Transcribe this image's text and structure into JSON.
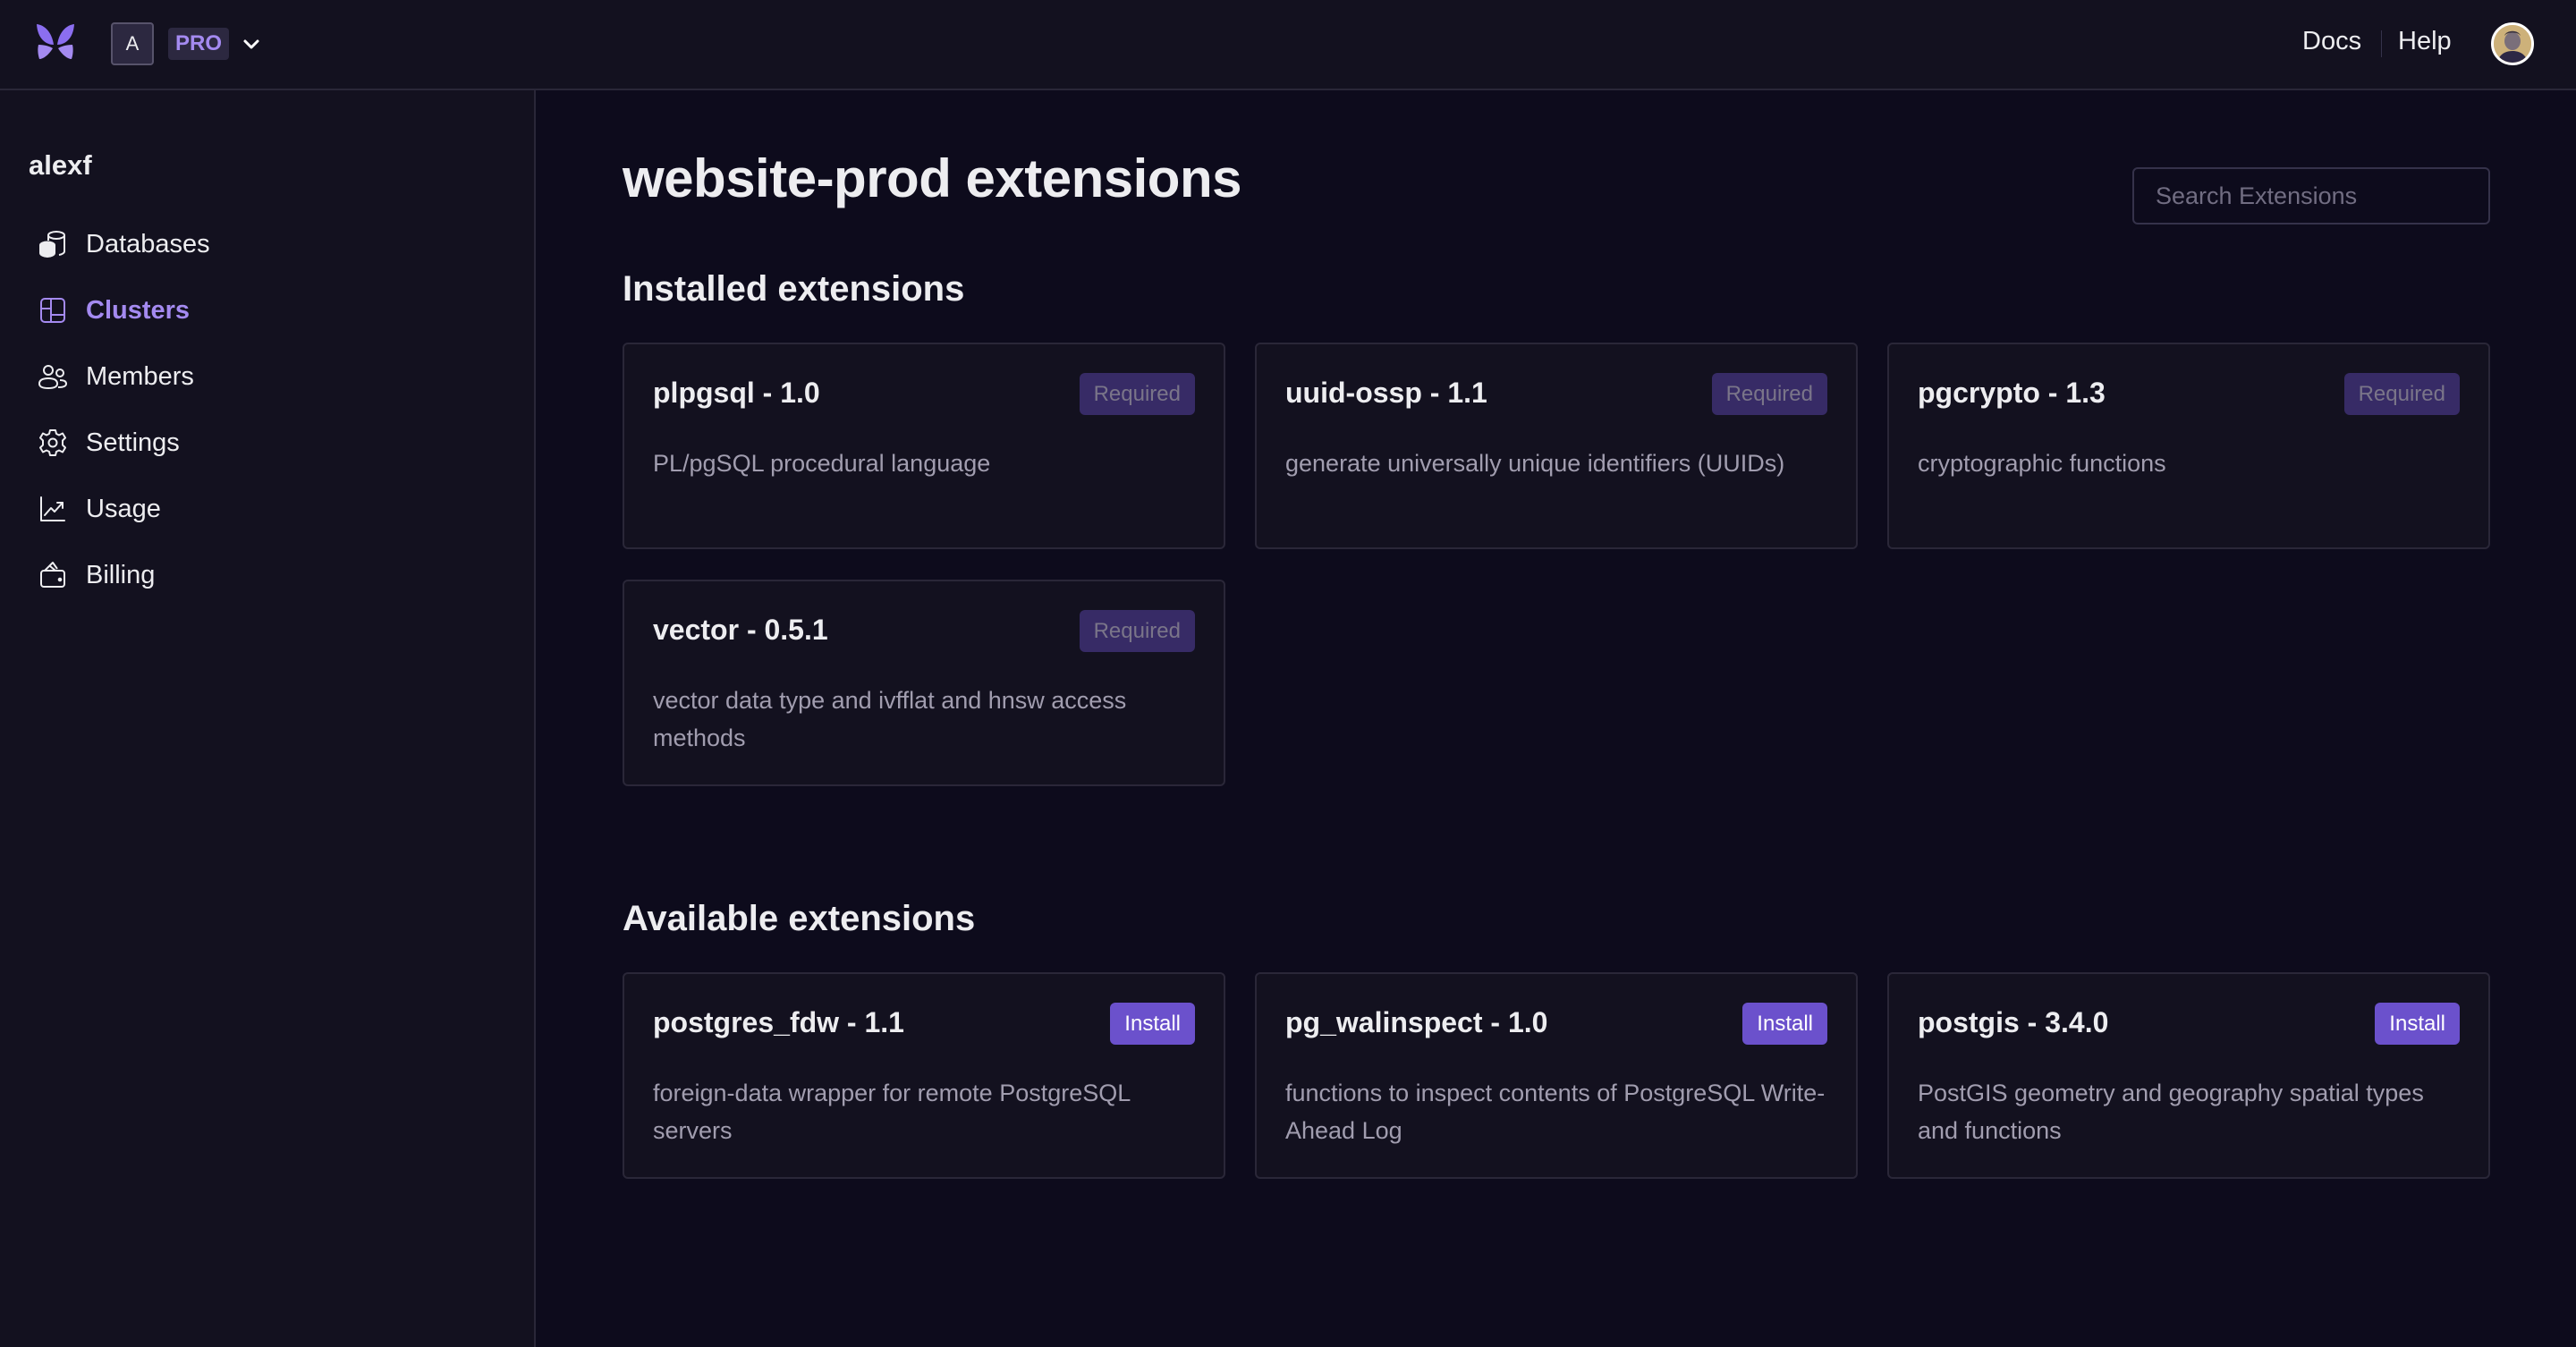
{
  "header": {
    "logo_icon": "butterfly-logo-icon",
    "org_initial": "A",
    "plan": "PRO",
    "org_menu_icon": "chevron-down-icon",
    "links": [
      {
        "label": "Docs"
      },
      {
        "label": "Help"
      }
    ],
    "avatar_icon": "user-avatar"
  },
  "sidebar": {
    "user": "alexf",
    "items": [
      {
        "label": "Databases",
        "icon": "database-icon",
        "active": false
      },
      {
        "label": "Clusters",
        "icon": "clusters-icon",
        "active": true
      },
      {
        "label": "Members",
        "icon": "members-icon",
        "active": false
      },
      {
        "label": "Settings",
        "icon": "gear-icon",
        "active": false
      },
      {
        "label": "Usage",
        "icon": "chart-line-icon",
        "active": false
      },
      {
        "label": "Billing",
        "icon": "wallet-icon",
        "active": false
      }
    ]
  },
  "main": {
    "title": "website-prod extensions",
    "search": {
      "placeholder": "Search Extensions",
      "value": ""
    },
    "installed": {
      "title": "Installed extensions",
      "items": [
        {
          "name": "plpgsql - 1.0",
          "description": "PL/pgSQL procedural language",
          "badge": "Required"
        },
        {
          "name": "uuid-ossp - 1.1",
          "description": "generate universally unique identifiers (UUIDs)",
          "badge": "Required"
        },
        {
          "name": "pgcrypto - 1.3",
          "description": "cryptographic functions",
          "badge": "Required"
        },
        {
          "name": "vector - 0.5.1",
          "description": "vector data type and ivfflat and hnsw access methods",
          "badge": "Required"
        }
      ]
    },
    "available": {
      "title": "Available extensions",
      "items": [
        {
          "name": "postgres_fdw - 1.1",
          "description": "foreign-data wrapper for remote PostgreSQL servers",
          "action": "Install"
        },
        {
          "name": "pg_walinspect - 1.0",
          "description": "functions to inspect contents of PostgreSQL Write-Ahead Log",
          "action": "Install"
        },
        {
          "name": "postgis - 3.4.0",
          "description": "PostGIS geometry and geography spatial types and functions",
          "action": "Install"
        }
      ]
    }
  },
  "colors": {
    "accent": "#a48af0",
    "install_button": "#6b51cc",
    "required_badge": "#372b66",
    "background": "#0d0b1c",
    "panel": "#13111f"
  }
}
